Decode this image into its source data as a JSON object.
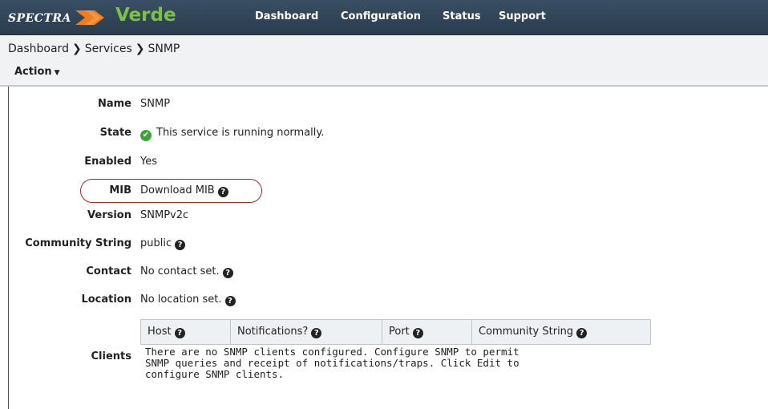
{
  "brand": {
    "prefix": "SPECTRA",
    "name": "Verde",
    "name_color": "#7cc242",
    "arrow_color": "#f07c1f"
  },
  "nav": {
    "items": [
      {
        "label": "Dashboard"
      },
      {
        "label": "Configuration"
      },
      {
        "label": "Status"
      },
      {
        "label": "Support"
      }
    ]
  },
  "breadcrumb": {
    "items": [
      {
        "label": "Dashboard"
      },
      {
        "label": "Services"
      },
      {
        "label": "SNMP"
      }
    ],
    "separator": "❯"
  },
  "action": {
    "label": "Action",
    "caret": "▼"
  },
  "details": {
    "name": {
      "label": "Name",
      "value": "SNMP"
    },
    "state": {
      "label": "State",
      "value": "This service is running normally.",
      "icon": "check-circle-icon",
      "status_color": "#3fa33a"
    },
    "enabled": {
      "label": "Enabled",
      "value": "Yes"
    },
    "mib": {
      "label": "MIB",
      "value": "Download MIB",
      "icon": "help-icon"
    },
    "version": {
      "label": "Version",
      "value": "SNMPv2c"
    },
    "community": {
      "label": "Community String",
      "value": "public",
      "icon": "help-icon"
    },
    "contact": {
      "label": "Contact",
      "value": "No contact set.",
      "icon": "help-icon"
    },
    "location": {
      "label": "Location",
      "value": "No location set.",
      "icon": "help-icon"
    }
  },
  "clients": {
    "label": "Clients",
    "columns": [
      {
        "label": "Host"
      },
      {
        "label": "Notifications?"
      },
      {
        "label": "Port"
      },
      {
        "label": "Community String"
      }
    ],
    "empty_message": "There are no SNMP clients configured. Configure SNMP to permit\nSNMP queries and receipt of notifications/traps. Click Edit to\nconfigure SNMP clients."
  },
  "highlight_color": "#9b2b2b"
}
